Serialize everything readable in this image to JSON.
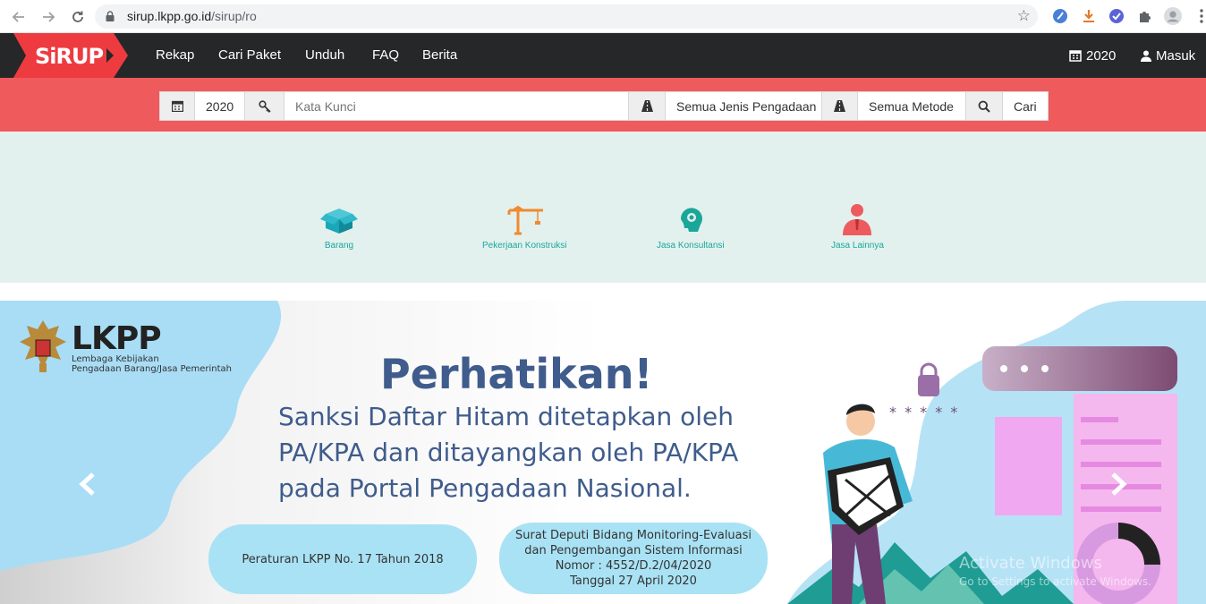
{
  "browser": {
    "url_host": "sirup.lkpp.go.id",
    "url_path": "/sirup/ro",
    "back_icon": "arrow-left-icon",
    "forward_icon": "arrow-right-icon",
    "reload_icon": "reload-icon",
    "star_icon": "star-icon"
  },
  "navbar": {
    "logo_text": "SiRUP",
    "menu": [
      "Rekap",
      "Cari Paket",
      "Unduh",
      "FAQ",
      "Berita"
    ],
    "year_label": "2020",
    "login_label": "Masuk"
  },
  "search": {
    "year": "2020",
    "keyword_placeholder": "Kata Kunci",
    "procurement_type": "Semua Jenis Pengadaan",
    "method": "Semua Metode",
    "button_label": "Cari"
  },
  "categories": [
    {
      "label": "Barang",
      "icon": "box-icon",
      "color": "#1aa7b8"
    },
    {
      "label": "Pekerjaan Konstruksi",
      "icon": "crane-icon",
      "color": "#f08a2e"
    },
    {
      "label": "Jasa Konsultansi",
      "icon": "consultant-head-icon",
      "color": "#1aa79a"
    },
    {
      "label": "Jasa Lainnya",
      "icon": "person-icon",
      "color": "#ee5b5e"
    }
  ],
  "banner": {
    "org_short": "LKPP",
    "org_line1": "Lembaga Kebijakan",
    "org_line2": "Pengadaan Barang/Jasa Pemerintah",
    "title": "Perhatikan!",
    "line1": "Sanksi Daftar Hitam ditetapkan oleh",
    "line2": "PA/KPA dan ditayangkan oleh PA/KPA",
    "line3": "pada Portal Pengadaan Nasional.",
    "pill1": "Peraturan LKPP No. 17 Tahun 2018",
    "pill2_lines": [
      "Surat Deputi Bidang Monitoring-Evaluasi",
      "dan Pengembangan Sistem Informasi",
      "Nomor : 4552/D.2/04/2020",
      "Tanggal 27 April 2020"
    ],
    "password_mask": "* * * * *",
    "prev_icon": "chevron-left-icon",
    "next_icon": "chevron-right-icon"
  },
  "watermark": {
    "title": "Activate Windows",
    "subtitle": "Go to Settings to activate Windows."
  },
  "colors": {
    "navbar_bg": "#252728",
    "search_band": "#ef5a5d",
    "category_bg": "#e3f1ee",
    "banner_text": "#3f5c8c"
  }
}
